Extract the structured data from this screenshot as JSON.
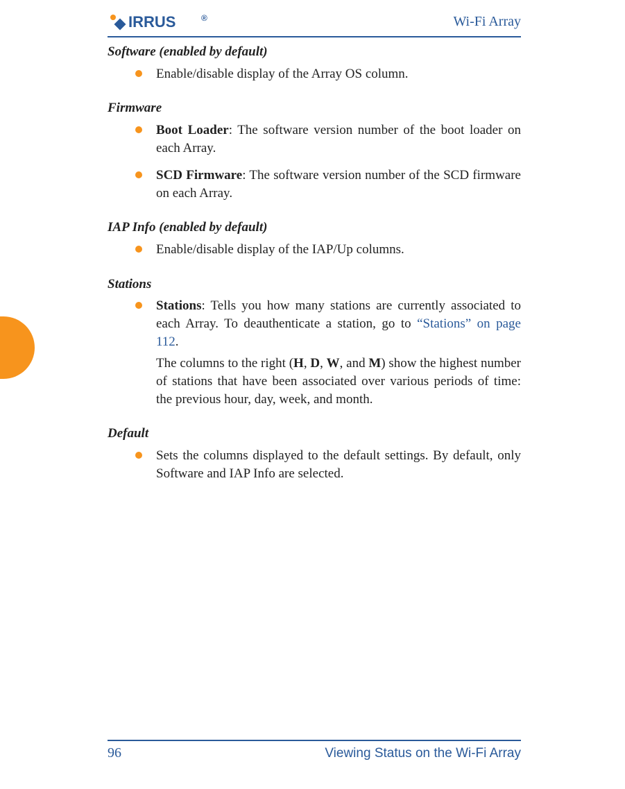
{
  "header": {
    "logo_text": "XIRRUS",
    "title": "Wi-Fi Array"
  },
  "sections": {
    "software": {
      "heading": "Software (enabled by default)",
      "item": "Enable/disable display of the Array OS column."
    },
    "firmware": {
      "heading": "Firmware",
      "boot_label": "Boot Loader",
      "boot_text": ": The software version number of the boot loader on each Array.",
      "scd_label": "SCD Firmware",
      "scd_text": ": The software version number of the SCD firmware on each Array."
    },
    "iap": {
      "heading": "IAP Info (enabled by default)",
      "item": "Enable/disable display of the IAP/Up columns."
    },
    "stations": {
      "heading": "Stations",
      "label": "Stations",
      "text_before_link": ": Tells you how many stations are currently associated to each Array. To deauthenticate a station, go to ",
      "link_text": "“Stations” on page 112",
      "after_link_period": ".",
      "para_pre": "The columns to the right (",
      "h": "H",
      "sep1": ", ",
      "d": "D",
      "sep2": ", ",
      "w": "W",
      "sep3": ", and ",
      "m": "M",
      "para_post": ") show the highest number of stations that have been associated over various periods of time: the previous hour, day, week, and month."
    },
    "default": {
      "heading": "Default",
      "item": "Sets the columns displayed to the default settings. By default, only Software and IAP Info are selected."
    }
  },
  "footer": {
    "page_number": "96",
    "chapter": "Viewing Status on the Wi-Fi Array"
  }
}
